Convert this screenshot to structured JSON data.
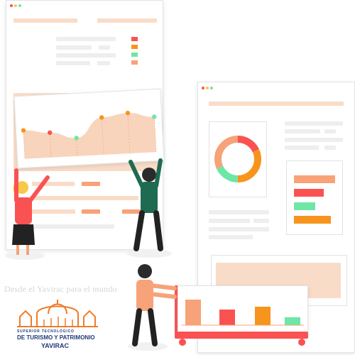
{
  "watermark": "Desde el Yavirac para el mundo",
  "logo": {
    "line1": "SUPERIOR TECNOLÓGICO",
    "line2": "DE TURISMO Y PATRIMONIO",
    "line3": "YAVIRAC"
  },
  "colors": {
    "accent_orange": "#f7941d",
    "peach": "#f9d4bd",
    "red": "#fa5252",
    "green": "#6ee6a6",
    "soft_orange": "#f7a278",
    "logo_blue": "#1f3a7a",
    "logo_orange": "#f07c2a"
  },
  "left_window_legend": [
    "#fa5252",
    "#f7941d",
    "#6ee6a6",
    "#f7a278"
  ],
  "donut_segments": [
    {
      "color": "#fa5252",
      "fraction": 0.18
    },
    {
      "color": "#f7941d",
      "fraction": 0.32
    },
    {
      "color": "#6ee6a6",
      "fraction": 0.18
    },
    {
      "color": "#f7a278",
      "fraction": 0.32
    }
  ],
  "hbar_values": [
    {
      "color": "#f7a278",
      "value": 1.0
    },
    {
      "color": "#fa5252",
      "value": 0.72
    },
    {
      "color": "#6ee6a6",
      "value": 0.52
    },
    {
      "color": "#f7941d",
      "value": 0.9
    }
  ],
  "cart_bars": [
    {
      "color": "#f7a278",
      "value": 0.9
    },
    {
      "color": "#fa5252",
      "value": 0.55
    },
    {
      "color": "#f7941d",
      "value": 0.65
    },
    {
      "color": "#6ee6a6",
      "value": 0.28
    }
  ],
  "line_points": [
    {
      "color": "#f7941d",
      "value": 0.55
    },
    {
      "color": "#fa5252",
      "value": 0.48
    },
    {
      "color": "#6ee6a6",
      "value": 0.35
    },
    {
      "color": "#f7941d",
      "value": 0.72
    },
    {
      "color": "#f7941d",
      "value": 0.78
    },
    {
      "color": "#6ee6a6",
      "value": 0.68
    }
  ],
  "icons": [
    "window-dots-icon",
    "donut-chart-icon",
    "line-chart-icon",
    "bar-chart-icon",
    "hbar-chart-icon",
    "person-icon",
    "institution-logo-icon"
  ]
}
